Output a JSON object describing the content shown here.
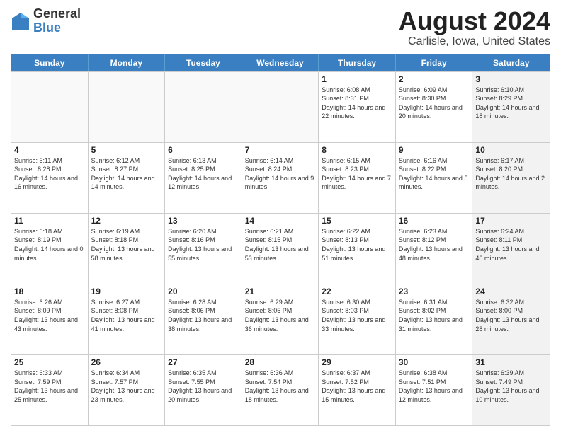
{
  "header": {
    "logo_general": "General",
    "logo_blue": "Blue",
    "main_title": "August 2024",
    "subtitle": "Carlisle, Iowa, United States"
  },
  "calendar": {
    "days_of_week": [
      "Sunday",
      "Monday",
      "Tuesday",
      "Wednesday",
      "Thursday",
      "Friday",
      "Saturday"
    ],
    "rows": [
      [
        {
          "day": "",
          "empty": true
        },
        {
          "day": "",
          "empty": true
        },
        {
          "day": "",
          "empty": true
        },
        {
          "day": "",
          "empty": true
        },
        {
          "day": "1",
          "sunrise": "6:08 AM",
          "sunset": "8:31 PM",
          "daylight": "14 hours and 22 minutes."
        },
        {
          "day": "2",
          "sunrise": "6:09 AM",
          "sunset": "8:30 PM",
          "daylight": "14 hours and 20 minutes."
        },
        {
          "day": "3",
          "sunrise": "6:10 AM",
          "sunset": "8:29 PM",
          "daylight": "14 hours and 18 minutes.",
          "shaded": true
        }
      ],
      [
        {
          "day": "4",
          "sunrise": "6:11 AM",
          "sunset": "8:28 PM",
          "daylight": "14 hours and 16 minutes."
        },
        {
          "day": "5",
          "sunrise": "6:12 AM",
          "sunset": "8:27 PM",
          "daylight": "14 hours and 14 minutes."
        },
        {
          "day": "6",
          "sunrise": "6:13 AM",
          "sunset": "8:25 PM",
          "daylight": "14 hours and 12 minutes."
        },
        {
          "day": "7",
          "sunrise": "6:14 AM",
          "sunset": "8:24 PM",
          "daylight": "14 hours and 9 minutes."
        },
        {
          "day": "8",
          "sunrise": "6:15 AM",
          "sunset": "8:23 PM",
          "daylight": "14 hours and 7 minutes."
        },
        {
          "day": "9",
          "sunrise": "6:16 AM",
          "sunset": "8:22 PM",
          "daylight": "14 hours and 5 minutes."
        },
        {
          "day": "10",
          "sunrise": "6:17 AM",
          "sunset": "8:20 PM",
          "daylight": "14 hours and 2 minutes.",
          "shaded": true
        }
      ],
      [
        {
          "day": "11",
          "sunrise": "6:18 AM",
          "sunset": "8:19 PM",
          "daylight": "14 hours and 0 minutes."
        },
        {
          "day": "12",
          "sunrise": "6:19 AM",
          "sunset": "8:18 PM",
          "daylight": "13 hours and 58 minutes."
        },
        {
          "day": "13",
          "sunrise": "6:20 AM",
          "sunset": "8:16 PM",
          "daylight": "13 hours and 55 minutes."
        },
        {
          "day": "14",
          "sunrise": "6:21 AM",
          "sunset": "8:15 PM",
          "daylight": "13 hours and 53 minutes."
        },
        {
          "day": "15",
          "sunrise": "6:22 AM",
          "sunset": "8:13 PM",
          "daylight": "13 hours and 51 minutes."
        },
        {
          "day": "16",
          "sunrise": "6:23 AM",
          "sunset": "8:12 PM",
          "daylight": "13 hours and 48 minutes."
        },
        {
          "day": "17",
          "sunrise": "6:24 AM",
          "sunset": "8:11 PM",
          "daylight": "13 hours and 46 minutes.",
          "shaded": true
        }
      ],
      [
        {
          "day": "18",
          "sunrise": "6:26 AM",
          "sunset": "8:09 PM",
          "daylight": "13 hours and 43 minutes."
        },
        {
          "day": "19",
          "sunrise": "6:27 AM",
          "sunset": "8:08 PM",
          "daylight": "13 hours and 41 minutes."
        },
        {
          "day": "20",
          "sunrise": "6:28 AM",
          "sunset": "8:06 PM",
          "daylight": "13 hours and 38 minutes."
        },
        {
          "day": "21",
          "sunrise": "6:29 AM",
          "sunset": "8:05 PM",
          "daylight": "13 hours and 36 minutes."
        },
        {
          "day": "22",
          "sunrise": "6:30 AM",
          "sunset": "8:03 PM",
          "daylight": "13 hours and 33 minutes."
        },
        {
          "day": "23",
          "sunrise": "6:31 AM",
          "sunset": "8:02 PM",
          "daylight": "13 hours and 31 minutes."
        },
        {
          "day": "24",
          "sunrise": "6:32 AM",
          "sunset": "8:00 PM",
          "daylight": "13 hours and 28 minutes.",
          "shaded": true
        }
      ],
      [
        {
          "day": "25",
          "sunrise": "6:33 AM",
          "sunset": "7:59 PM",
          "daylight": "13 hours and 25 minutes."
        },
        {
          "day": "26",
          "sunrise": "6:34 AM",
          "sunset": "7:57 PM",
          "daylight": "13 hours and 23 minutes."
        },
        {
          "day": "27",
          "sunrise": "6:35 AM",
          "sunset": "7:55 PM",
          "daylight": "13 hours and 20 minutes."
        },
        {
          "day": "28",
          "sunrise": "6:36 AM",
          "sunset": "7:54 PM",
          "daylight": "13 hours and 18 minutes."
        },
        {
          "day": "29",
          "sunrise": "6:37 AM",
          "sunset": "7:52 PM",
          "daylight": "13 hours and 15 minutes."
        },
        {
          "day": "30",
          "sunrise": "6:38 AM",
          "sunset": "7:51 PM",
          "daylight": "13 hours and 12 minutes."
        },
        {
          "day": "31",
          "sunrise": "6:39 AM",
          "sunset": "7:49 PM",
          "daylight": "13 hours and 10 minutes.",
          "shaded": true
        }
      ]
    ]
  }
}
